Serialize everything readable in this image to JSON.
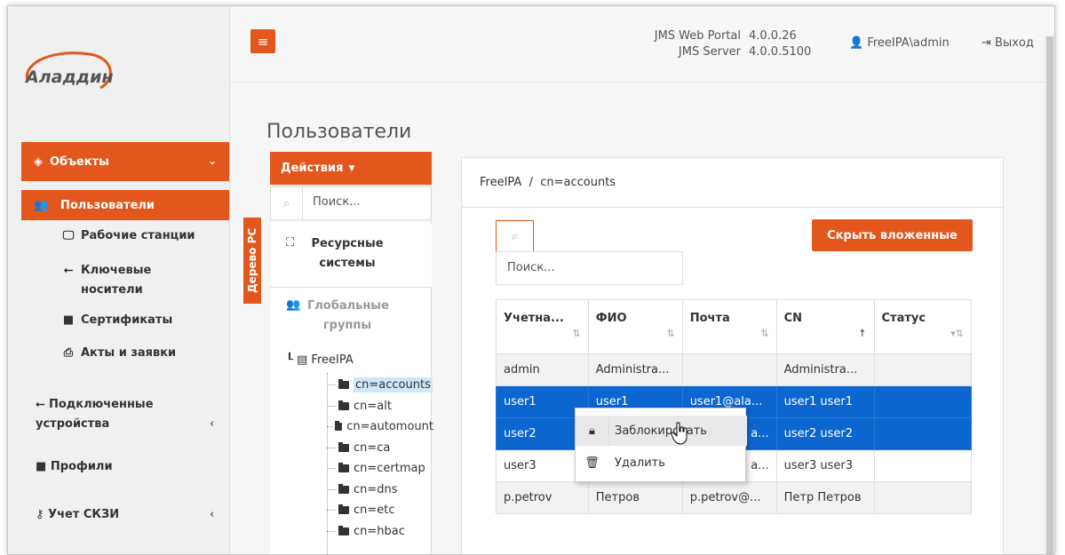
{
  "logo": {
    "text": "Аладдин"
  },
  "header": {
    "menu_icon": "hamburger-icon",
    "versions": [
      {
        "label": "JMS Web Portal",
        "value": "4.0.0.26"
      },
      {
        "label": "JMS Server",
        "value": "4.0.0.5100"
      }
    ],
    "user": "FreeIPA\\admin",
    "logout": "Выход"
  },
  "sidebar": {
    "group_objects": "Объекты",
    "items": [
      {
        "label": "Пользователи",
        "icon": "users-icon"
      },
      {
        "label": "Рабочие станции",
        "icon": "monitor-icon"
      },
      {
        "label": "Ключевые носители",
        "icon": "usb-icon"
      },
      {
        "label": "Сертификаты",
        "icon": "file-icon"
      },
      {
        "label": "Акты и заявки",
        "icon": "printer-icon"
      }
    ],
    "top_items": [
      {
        "label": "Подключенные устройства",
        "icon": "usb-icon"
      },
      {
        "label": "Профили",
        "icon": "folder-icon"
      },
      {
        "label": "Учет СКЗИ",
        "icon": "key-icon"
      }
    ]
  },
  "page": {
    "title": "Пользователи"
  },
  "left_panel": {
    "actions_label": "Действия",
    "search_placeholder": "Поиск...",
    "tree_tab": "Дерево РС",
    "tab_resources": "Ресурсные системы",
    "tab_groups": "Глобальные группы",
    "tree": {
      "root": "FreeIPA",
      "nodes": [
        "cn=accounts",
        "cn=alt",
        "cn=automount",
        "cn=ca",
        "cn=certmap",
        "cn=dns",
        "cn=etc",
        "cn=hbac"
      ],
      "selected": "cn=accounts"
    }
  },
  "right_panel": {
    "breadcrumb": "FreeIPA  /  cn=accounts",
    "search_placeholder": "Поиск...",
    "hide_nested": "Скрыть вложенные",
    "columns": [
      "Учетна...",
      "ФИО",
      "Почта",
      "CN",
      "Статус"
    ],
    "rows": [
      {
        "account": "admin",
        "fio": "Administra...",
        "mail": "",
        "cn": "Administra...",
        "status": ""
      },
      {
        "account": "user1",
        "fio": "user1",
        "mail": "user1@ala...",
        "cn": "user1 user1",
        "status": ""
      },
      {
        "account": "user2",
        "fio": "",
        "mail": "a...",
        "cn": "user2 user2",
        "status": ""
      },
      {
        "account": "user3",
        "fio": "",
        "mail": "a...",
        "cn": "user3 user3",
        "status": ""
      },
      {
        "account": "p.petrov",
        "fio": "Петров",
        "mail": "p.petrov@...",
        "cn": "Петр Петров",
        "status": ""
      }
    ]
  },
  "context_menu": {
    "items": [
      {
        "label": "Заблокировать",
        "icon": "lock-icon"
      },
      {
        "label": "Удалить",
        "icon": "trash-icon"
      }
    ]
  },
  "colors": {
    "accent": "#e3571c",
    "selection": "#0b66cf"
  }
}
